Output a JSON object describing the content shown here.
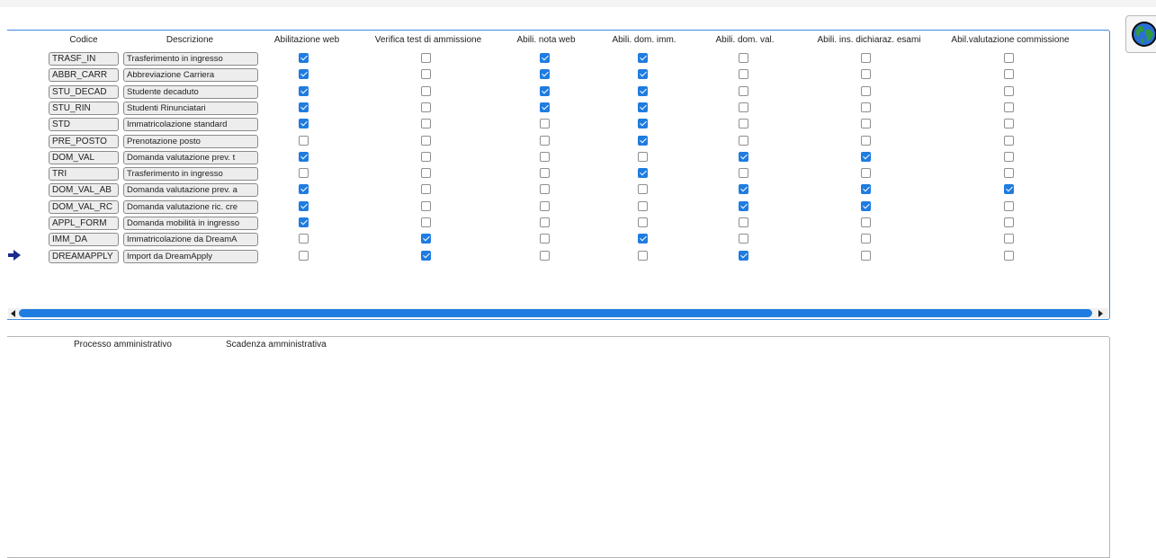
{
  "columns": {
    "code": "Codice",
    "description": "Descrizione",
    "web": "Abilitazione web",
    "test": "Verifica test di ammissione",
    "note": "Abili. nota web",
    "imm": "Abili. dom. imm.",
    "val": "Abili. dom. val.",
    "exams": "Abili. ins. dichiaraz. esami",
    "commission": "Abil.valutazione commissione"
  },
  "rows": [
    {
      "code": "TRASF_IN",
      "description": "Trasferimento in ingresso",
      "flags": [
        true,
        false,
        true,
        true,
        false,
        false,
        false
      ]
    },
    {
      "code": "ABBR_CARR",
      "description": "Abbreviazione Carriera",
      "flags": [
        true,
        false,
        true,
        true,
        false,
        false,
        false
      ]
    },
    {
      "code": "STU_DECAD",
      "description": "Studente decaduto",
      "flags": [
        true,
        false,
        true,
        true,
        false,
        false,
        false
      ]
    },
    {
      "code": "STU_RIN",
      "description": "Studenti Rinunciatari",
      "flags": [
        true,
        false,
        true,
        true,
        false,
        false,
        false
      ]
    },
    {
      "code": "STD",
      "description": "Immatricolazione standard",
      "flags": [
        true,
        false,
        false,
        true,
        false,
        false,
        false
      ]
    },
    {
      "code": "PRE_POSTO",
      "description": "Prenotazione posto",
      "flags": [
        false,
        false,
        false,
        true,
        false,
        false,
        false
      ]
    },
    {
      "code": "DOM_VAL",
      "description": "Domanda valutazione prev. t",
      "flags": [
        true,
        false,
        false,
        false,
        true,
        true,
        false
      ]
    },
    {
      "code": "TRI",
      "description": "Trasferimento in ingresso",
      "flags": [
        false,
        false,
        false,
        true,
        false,
        false,
        false
      ]
    },
    {
      "code": "DOM_VAL_AB",
      "description": "Domanda valutazione prev. a",
      "flags": [
        true,
        false,
        false,
        false,
        true,
        true,
        true
      ]
    },
    {
      "code": "DOM_VAL_RC",
      "description": "Domanda valutazione ric. cre",
      "flags": [
        true,
        false,
        false,
        false,
        true,
        true,
        false
      ]
    },
    {
      "code": "APPL_FORM",
      "description": "Domanda mobilità in ingresso",
      "flags": [
        true,
        false,
        false,
        false,
        false,
        false,
        false
      ]
    },
    {
      "code": "IMM_DA",
      "description": "Immatricolazione da DreamA",
      "flags": [
        false,
        true,
        false,
        true,
        false,
        false,
        false
      ]
    },
    {
      "code": "DREAMAPPLY",
      "description": "Import da DreamApply",
      "flags": [
        false,
        true,
        false,
        false,
        true,
        false,
        false
      ]
    }
  ],
  "current_row": "DREAMAPPLY",
  "lower": {
    "process_label": "Processo amministrativo",
    "deadline_label": "Scadenza amministrativa"
  },
  "icons": {
    "row_pointer": "arrow-right-icon",
    "globe": "globe-icon",
    "scroll_left": "scroll-left-icon",
    "scroll_right": "scroll-right-icon"
  },
  "colors": {
    "accent": "#1f7ce0",
    "panel_border": "#3b8be0"
  }
}
